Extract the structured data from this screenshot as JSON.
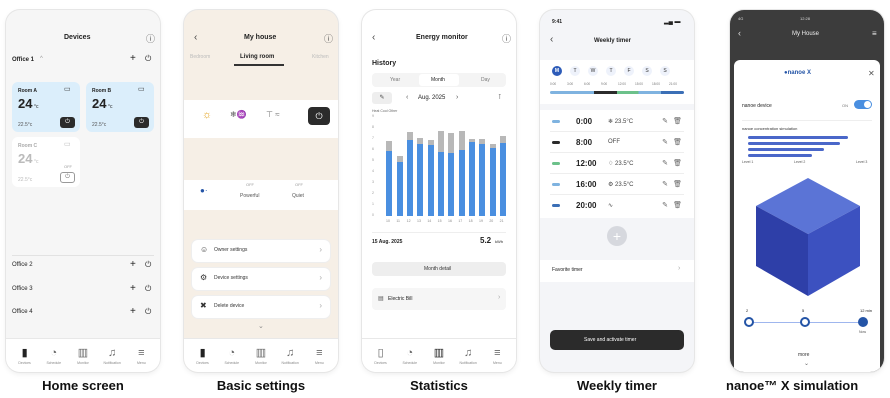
{
  "captions": [
    "Home screen",
    "Basic settings",
    "Statistics",
    "Weekly timer",
    "nanoe™ X simulation"
  ],
  "home": {
    "title": "Devices",
    "group1": "Office 1",
    "rooms": [
      {
        "name": "Room A",
        "temp": "24",
        "unit": "°c",
        "setpoint": "22.5°c"
      },
      {
        "name": "Room B",
        "temp": "24",
        "unit": "°c",
        "setpoint": "22.5°c"
      },
      {
        "name": "Room C",
        "temp": "24",
        "unit": "°c",
        "setpoint": "22.5°c",
        "state": "OFF"
      }
    ],
    "groups": [
      "Office 2",
      "Office 3",
      "Office 4"
    ],
    "tabs": [
      "Devices",
      "Schedule",
      "Monitor",
      "Notification",
      "Menu"
    ]
  },
  "basic": {
    "title": "My house",
    "tabs": [
      "Bedroom",
      "Living room",
      "Kitchen"
    ],
    "modes": [
      "Powerful",
      "Quiet"
    ],
    "off": "OFF",
    "settings": [
      "Owner settings",
      "Device settings",
      "Delete device"
    ]
  },
  "stats": {
    "title": "Energy monitor",
    "section": "History",
    "periods": [
      "Year",
      "Month",
      "Day"
    ],
    "month": "Aug. 2025",
    "legend": "Heat  Cool  Other",
    "selected_date": "15 Aug. 2025",
    "selected_value": "5.2",
    "selected_unit": "kWh",
    "detail_btn": "Month detail",
    "bill": "Electric Bill",
    "xlabels": [
      "10",
      "11",
      "12",
      "13",
      "14",
      "15",
      "16",
      "17",
      "18",
      "19",
      "20",
      "21"
    ]
  },
  "chart_data": {
    "type": "bar",
    "categories": [
      "10",
      "11",
      "12",
      "13",
      "14",
      "15",
      "16",
      "17",
      "18",
      "19",
      "20",
      "21"
    ],
    "series": [
      {
        "name": "Heat",
        "values": [
          6.5,
          5.4,
          7.6,
          7.2,
          7.1,
          6.4,
          6.3,
          6.6,
          7.4,
          7.2,
          6.8,
          7.3
        ]
      },
      {
        "name": "Other",
        "values": [
          1.0,
          0.6,
          0.8,
          0.6,
          0.5,
          2.1,
          2.0,
          1.9,
          0.3,
          0.5,
          0.4,
          0.7
        ]
      }
    ],
    "ylim": [
      0,
      10
    ],
    "yticks": [
      "9",
      "8",
      "7",
      "6",
      "5",
      "4",
      "3",
      "2",
      "1",
      "0"
    ]
  },
  "timer": {
    "status_time": "9:41",
    "title": "Weekly timer",
    "days": [
      "M",
      "T",
      "W",
      "T",
      "F",
      "S",
      "S"
    ],
    "hours": [
      "0:00",
      "3:00",
      "6:00",
      "9:00",
      "12:00",
      "15:00",
      "18:00",
      "21:00"
    ],
    "entries": [
      {
        "time": "0:00",
        "mode": "❄ 23.5°C",
        "color": "#7fb3e0"
      },
      {
        "time": "8:00",
        "mode": "OFF",
        "color": "#2b2b2b"
      },
      {
        "time": "12:00",
        "mode": "♢ 23.5°C",
        "color": "#6cc18a"
      },
      {
        "time": "16:00",
        "mode": "⚙ 23.5°C",
        "color": "#7fb3e0"
      },
      {
        "time": "20:00",
        "mode": "∿",
        "color": "#3b6fb6"
      }
    ],
    "favorite": "Favorite timer",
    "save": "Save and activate timer"
  },
  "nanoe": {
    "status_left": "4G",
    "status_time": "12:28",
    "title": "My House",
    "brand": "nanoe X",
    "device_label": "nanoe device",
    "on": "ON",
    "sim_title": "nanoe concentration simulation",
    "levels": [
      "Level 1",
      "Level 2",
      "Level 3"
    ],
    "slider_labels": [
      "2",
      "5",
      "12 min"
    ],
    "slider_now": "Now",
    "more": "more"
  },
  "colors": {
    "blue": "#4a8fe0",
    "accent": "#f6efe6",
    "dark": "#2b2b2b"
  }
}
